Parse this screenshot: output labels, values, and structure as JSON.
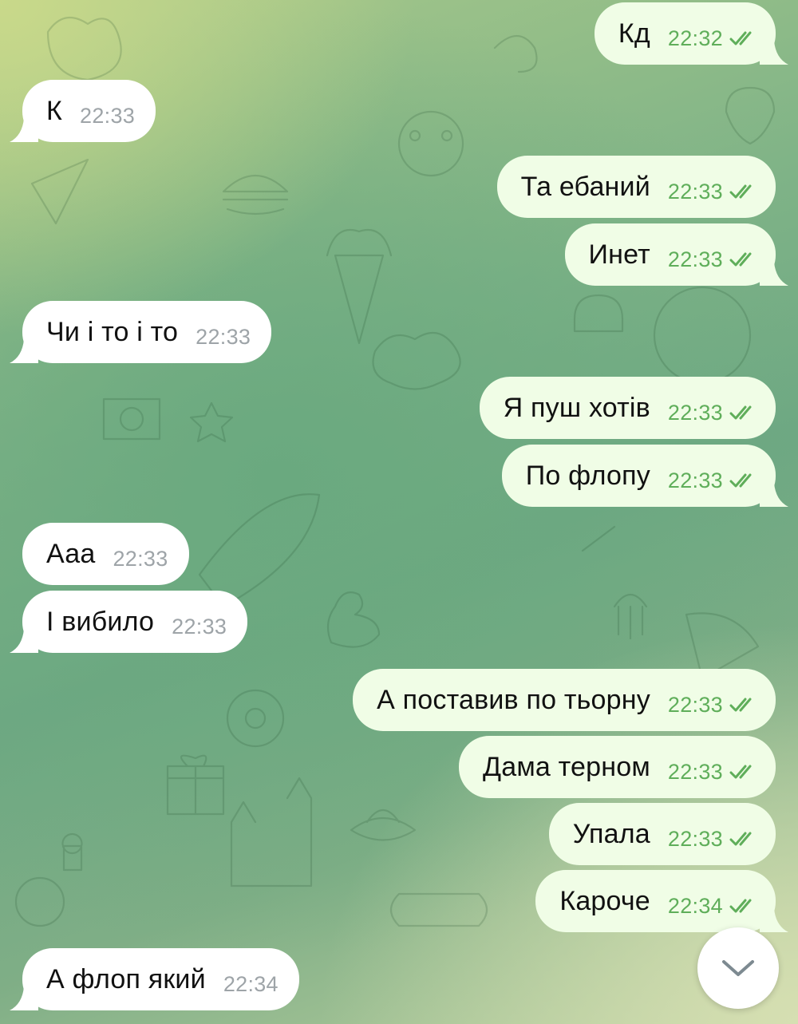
{
  "messages": [
    {
      "dir": "out",
      "text": "Кд",
      "time": "22:32",
      "read": true
    },
    {
      "dir": "in",
      "text": "К",
      "time": "22:33"
    },
    {
      "dir": "out",
      "text": "Та ебаний",
      "time": "22:33",
      "read": true
    },
    {
      "dir": "out",
      "text": "Инет",
      "time": "22:33",
      "read": true
    },
    {
      "dir": "in",
      "text": "Чи і то і то",
      "time": "22:33"
    },
    {
      "dir": "out",
      "text": "Я пуш хотів",
      "time": "22:33",
      "read": true
    },
    {
      "dir": "out",
      "text": "По флопу",
      "time": "22:33",
      "read": true
    },
    {
      "dir": "in",
      "text": "Ааа",
      "time": "22:33"
    },
    {
      "dir": "in",
      "text": "І вибило",
      "time": "22:33"
    },
    {
      "dir": "out",
      "text": "А поставив по тьорну",
      "time": "22:33",
      "read": true
    },
    {
      "dir": "out",
      "text": "Дама терном",
      "time": "22:33",
      "read": true
    },
    {
      "dir": "out",
      "text": "Упала",
      "time": "22:33",
      "read": true
    },
    {
      "dir": "out",
      "text": "Кароче",
      "time": "22:34",
      "read": true
    },
    {
      "dir": "in",
      "text": "А флоп який",
      "time": "22:34"
    }
  ],
  "scroll_button": {
    "icon": "chevron-down-icon"
  },
  "colors": {
    "incoming_bubble": "#ffffff",
    "outgoing_bubble": "#f0fde6",
    "outgoing_time": "#5fae5a",
    "incoming_time": "#9ea4a8"
  }
}
